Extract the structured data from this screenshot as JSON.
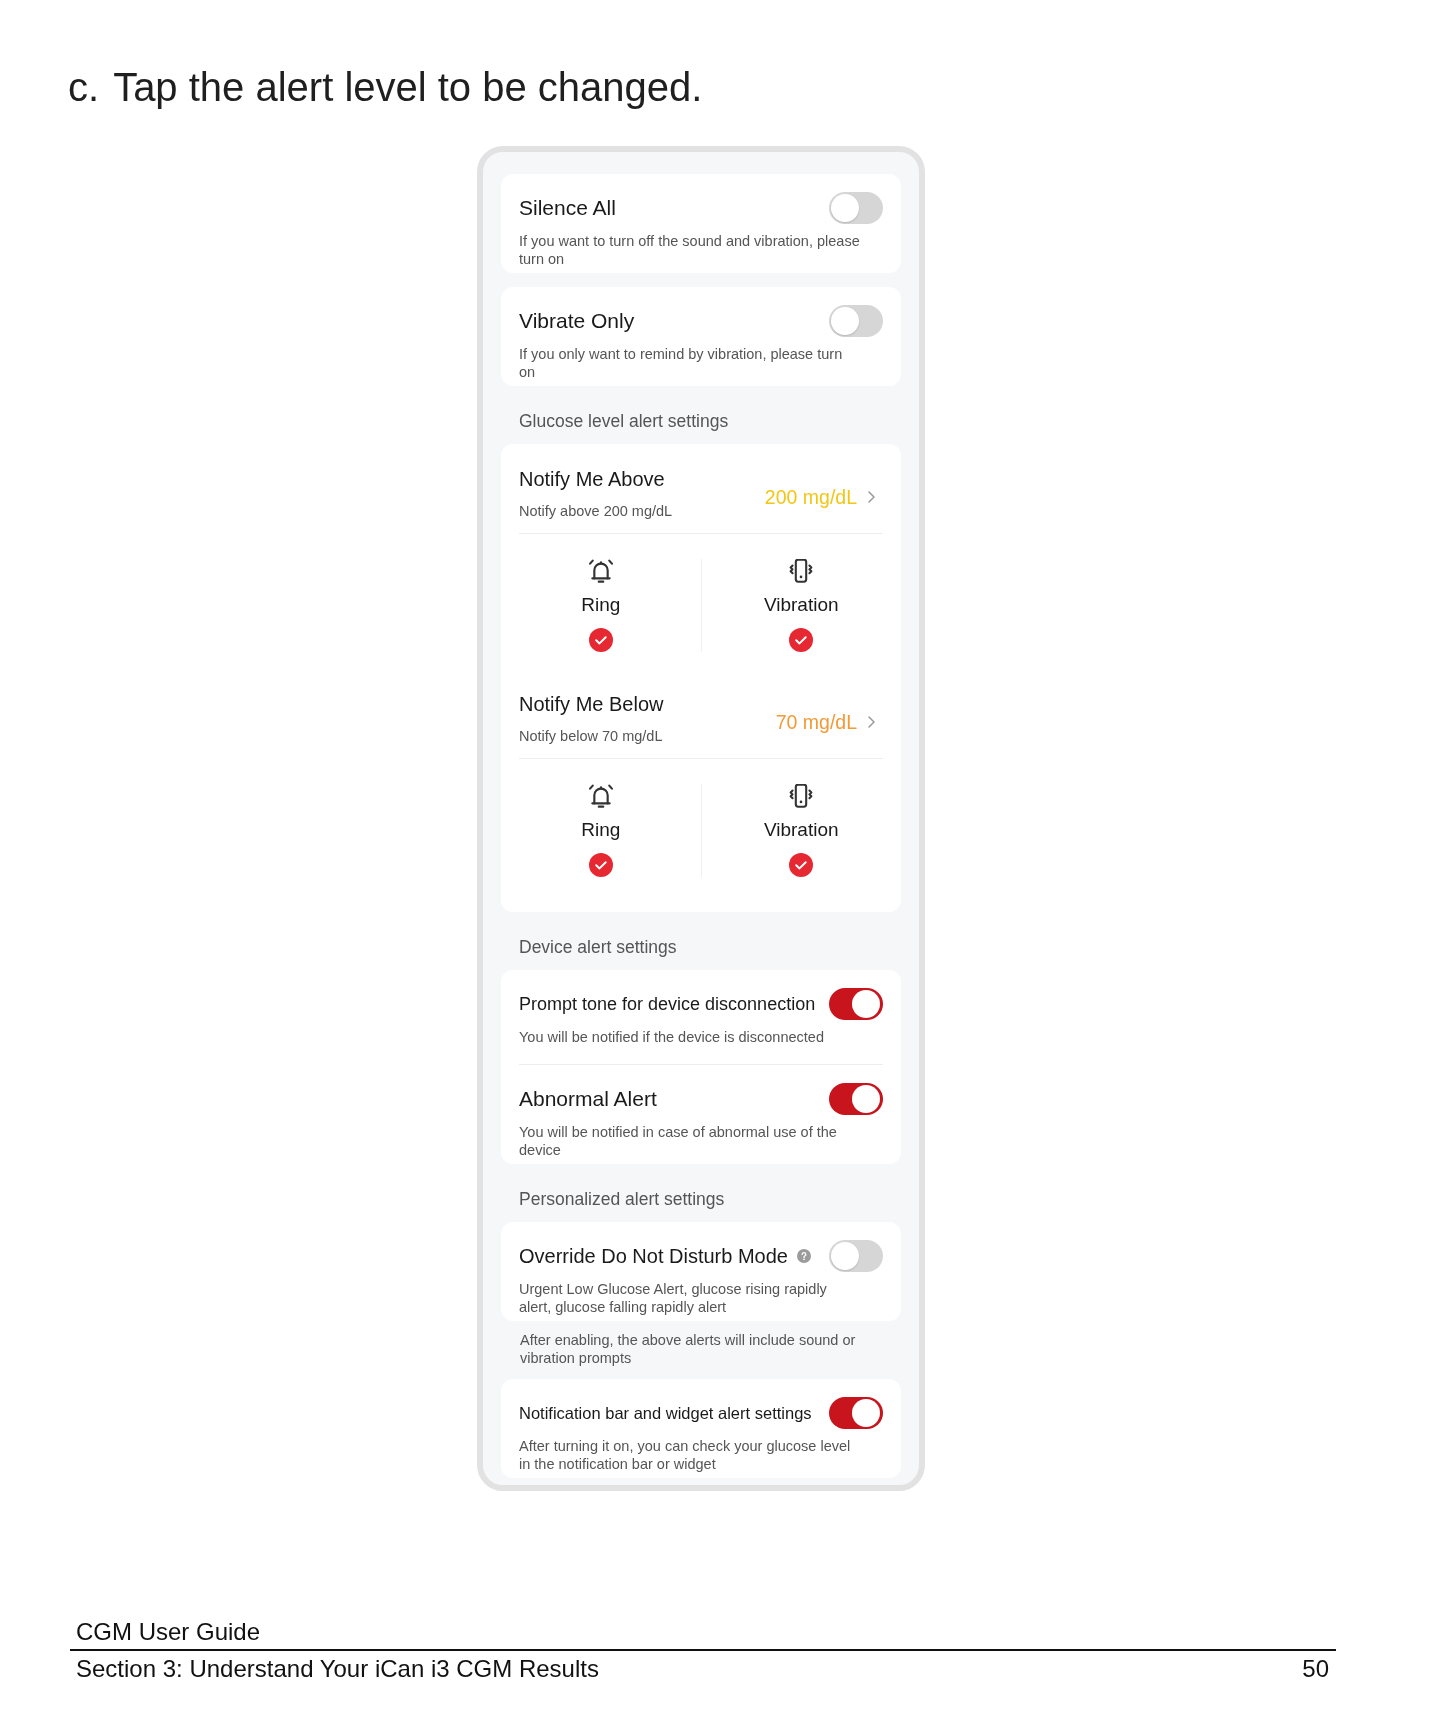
{
  "heading": {
    "marker": "c.",
    "text": "Tap the alert level to be changed."
  },
  "phone": {
    "blocks": [
      {
        "kind": "toggle_group",
        "items": [
          {
            "title": "Silence All",
            "description": "If you want to turn off the sound and vibration, please turn on",
            "on": false
          }
        ]
      },
      {
        "kind": "toggle_group",
        "items": [
          {
            "title": "Vibrate Only",
            "description": "If you only want to remind by vibration, please turn on",
            "on": false
          }
        ]
      },
      {
        "kind": "section_label",
        "text": "Glucose level alert settings"
      },
      {
        "kind": "alert_group",
        "alerts": [
          {
            "title": "Notify Me Above",
            "description": "Notify above 200 mg/dL",
            "value": "200 mg/dL",
            "color": "#f3c614",
            "options": [
              {
                "kind": "sound",
                "label": "Ring",
                "checked": true
              },
              {
                "kind": "vibration",
                "label": "Vibration",
                "checked": true
              }
            ]
          },
          {
            "title": "Notify Me Below",
            "description": "Notify below 70 mg/dL",
            "value": "70 mg/dL",
            "color": "#f39a36",
            "options": [
              {
                "kind": "sound",
                "label": "Ring",
                "checked": true
              },
              {
                "kind": "vibration",
                "label": "Vibration",
                "checked": true
              }
            ]
          }
        ]
      },
      {
        "kind": "section_label",
        "text": "Device alert settings"
      },
      {
        "kind": "toggle_group",
        "items": [
          {
            "title": "Prompt tone for device disconnection",
            "description": "You will be notified if the device is disconnected",
            "on": true
          },
          {
            "title": "Abnormal Alert",
            "description": "You will be notified in case of abnormal use of the device",
            "on": true
          }
        ]
      },
      {
        "kind": "section_label",
        "text": "Personalized alert settings"
      },
      {
        "kind": "toggle_group",
        "items": [
          {
            "title": "Override Do Not Disturb Mode",
            "help": true,
            "description": "Urgent Low Glucose Alert, glucose rising rapidly alert, glucose falling rapidly alert",
            "on": false
          }
        ]
      },
      {
        "kind": "note",
        "text": "After enabling, the above alerts will include sound or vibration prompts"
      },
      {
        "kind": "toggle_group",
        "items": [
          {
            "title": "Notification bar and widget alert settings",
            "description": "After turning it on, you can check your glucose level in the notification bar or widget",
            "on": true
          }
        ]
      }
    ]
  },
  "footer": {
    "guide_title": "CGM User Guide",
    "section": "Section 3: Understand Your iCan i3 CGM Results",
    "page_number": "50"
  }
}
